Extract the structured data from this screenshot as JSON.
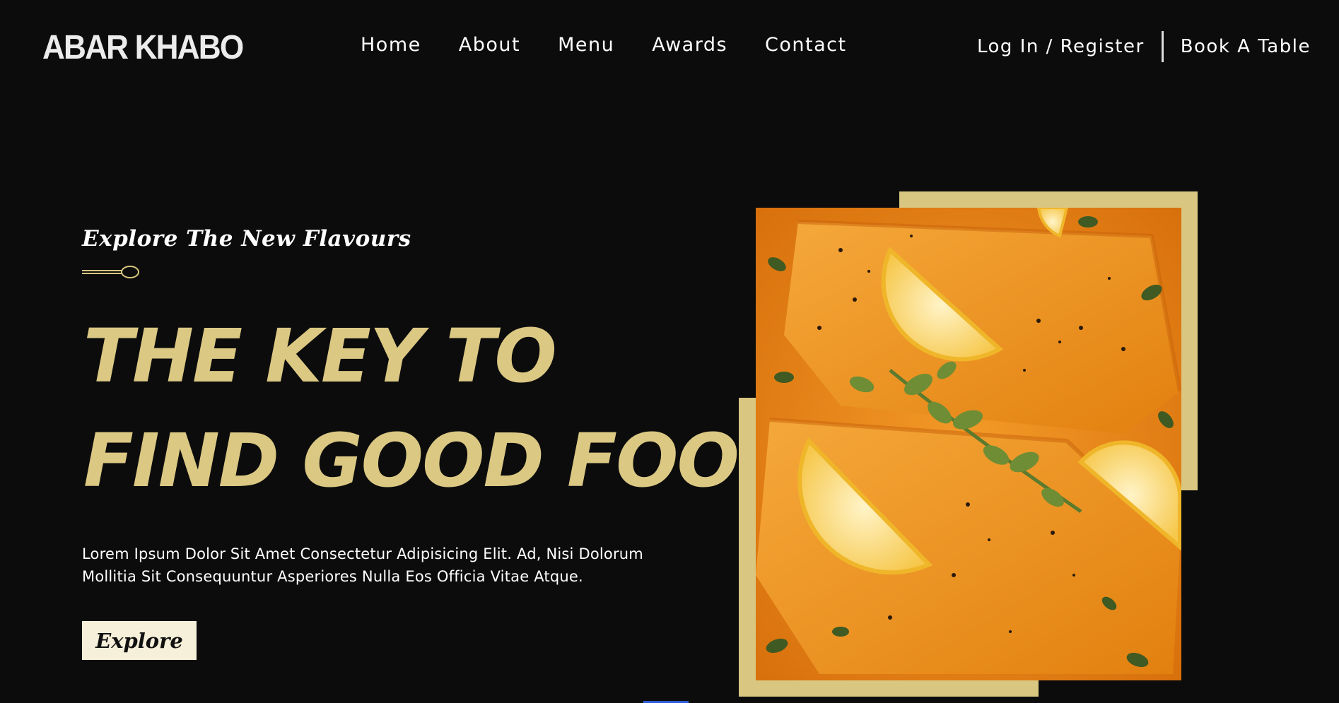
{
  "brand": {
    "name": "ABAR KHABO"
  },
  "nav": {
    "items": [
      {
        "label": "Home"
      },
      {
        "label": "About"
      },
      {
        "label": "Menu"
      },
      {
        "label": "Awards"
      },
      {
        "label": "Contact"
      }
    ]
  },
  "header_actions": {
    "login_label": "Log In / Register",
    "book_label": "Book A Table"
  },
  "hero": {
    "eyebrow": "Explore The New Flavours",
    "headline_line1": "THE KEY TO",
    "headline_line2": "FIND GOOD FOOD",
    "description": "Lorem Ipsum Dolor Sit Amet Consectetur Adipisicing Elit. Ad, Nisi Dolorum Mollitia Sit Consequuntur Asperiores Nulla Eos Officia Vitae Atque.",
    "cta_label": "Explore",
    "image_icon": "salmon-dish-photo"
  },
  "colors": {
    "background": "#0c0c0c",
    "accent_gold": "#dbc883",
    "frame_gold": "#d9c680",
    "button_bg": "#f6efd9",
    "text": "#ffffff"
  }
}
